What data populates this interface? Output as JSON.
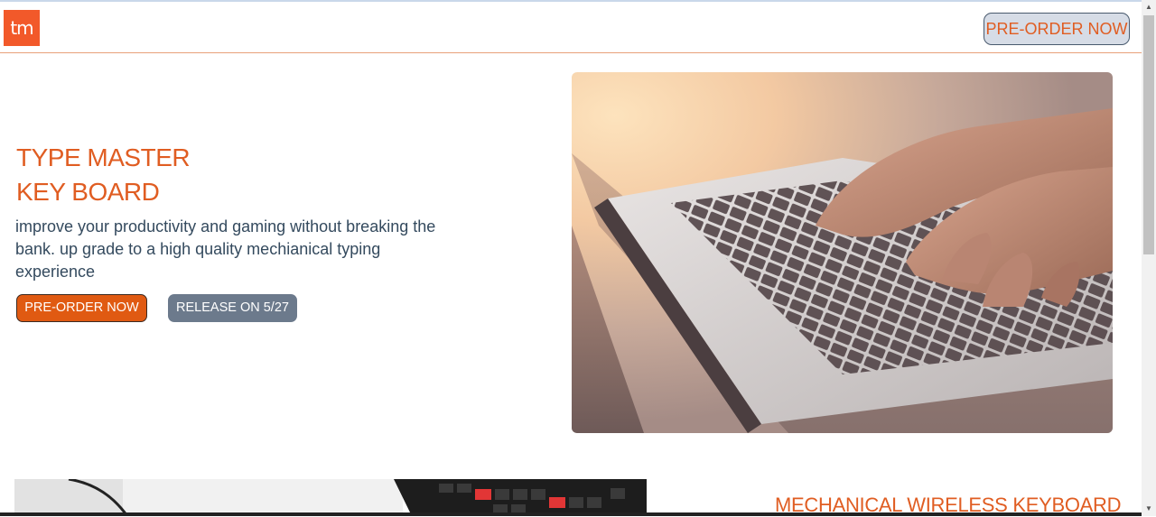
{
  "header": {
    "logo_text": "tm",
    "nav_button": "PRE-ORDER NOW"
  },
  "hero": {
    "title_line1": "TYPE MASTER",
    "title_line2": "KEY BOARD",
    "description": "improve your productivity and gaming without breaking the bank. up grade to a high quality mechianical typing experience",
    "primary_button": "PRE-ORDER NOW",
    "secondary_button": "RELEASE ON 5/27"
  },
  "section2": {
    "title": "MECHANICAL WIRELESS KEYBOARD"
  },
  "colors": {
    "accent": "#e05d22",
    "logo_bg": "#f2592a",
    "text": "#344a5e",
    "secondary_button": "#6c7a8c"
  },
  "icons": {
    "scroll_up": "scroll-up-arrow-icon",
    "scroll_down": "scroll-down-arrow-icon"
  }
}
